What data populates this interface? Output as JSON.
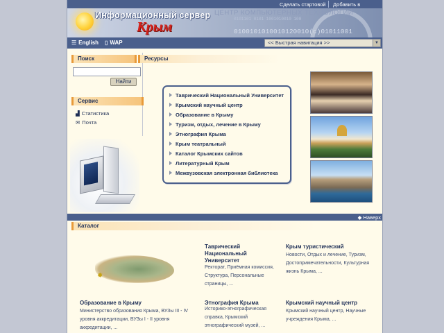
{
  "toplinks": {
    "start_page": "Сделать стартовой",
    "favorites": "Добавить в избранное"
  },
  "banner": {
    "title": "Информационный сервер",
    "subtitle": "Крым",
    "background_text": "ЦЕНТР КОМПЬЮТЕРНЫХ ТЕХНОЛОГИЙ",
    "binary": "0100101010010120010(c)01011001",
    "binary_small": "0101101 0101 1001010010 100"
  },
  "langbar": {
    "english": "English",
    "wap": "WAP",
    "quick_nav": "<<  Быстрая навигация  >>"
  },
  "search": {
    "header": "Поиск",
    "button": "Найти",
    "value": ""
  },
  "service": {
    "header": "Сервис",
    "items": [
      {
        "label": "Статистика",
        "icon": "chart-icon"
      },
      {
        "label": "Почта",
        "icon": "mail-icon"
      }
    ]
  },
  "resources": {
    "header": "Ресурсы",
    "items": [
      "Таврический Национальный Университет",
      "Крымский научный центр",
      "Образование в Крыму",
      "Туризм, отдых, лечение в Крыму",
      "Этнография Крыма",
      "Крым театральный",
      "Каталог Крымских сайтов",
      "Литературный Крым",
      "Межвузовская электронная библиотека"
    ]
  },
  "up_link": "Наверх",
  "catalog": {
    "header": "Каталог",
    "blocks": {
      "tnu": {
        "title": "Таврический Национальный Университет",
        "links": "Ректорат, Приёмная комиссия, Структура, Персональные страницы, ..."
      },
      "tourist": {
        "title": "Крым туристический",
        "links": "Новости, Отдых и лечение, Туризм, Достопримечательности, Культурная жизнь Крыма, ..."
      },
      "education": {
        "title": "Образование в Крыму",
        "links": "Министерство образования Крыма, ВУЗы III - IV уровня аккредитации, ВУЗы I - II уровня аккредитации, ..."
      },
      "ethnography": {
        "title": "Этнография Крыма",
        "links": "Историко-этнографическая справка, Крымский этнографический музей, ..."
      },
      "science": {
        "title": "Крымский научный центр",
        "links": "Крымский научный центр, Научные учреждения Крыма, ..."
      }
    }
  },
  "colors": {
    "nav_bar": "#4a5f8c",
    "page_bg": "#fffbea",
    "accent_orange": "#e89a3a",
    "title_red": "#d4211a"
  }
}
